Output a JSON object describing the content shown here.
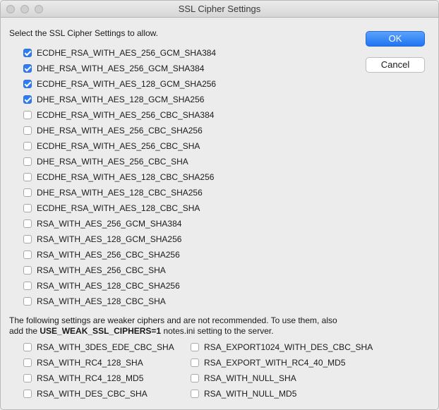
{
  "window": {
    "title": "SSL Cipher Settings"
  },
  "prompt": "Select the SSL Cipher Settings to allow.",
  "buttons": {
    "ok": "OK",
    "cancel": "Cancel"
  },
  "ciphers": [
    {
      "label": "ECDHE_RSA_WITH_AES_256_GCM_SHA384",
      "checked": true
    },
    {
      "label": "DHE_RSA_WITH_AES_256_GCM_SHA384",
      "checked": true
    },
    {
      "label": "ECDHE_RSA_WITH_AES_128_GCM_SHA256",
      "checked": true
    },
    {
      "label": "DHE_RSA_WITH_AES_128_GCM_SHA256",
      "checked": true
    },
    {
      "label": "ECDHE_RSA_WITH_AES_256_CBC_SHA384",
      "checked": false
    },
    {
      "label": "DHE_RSA_WITH_AES_256_CBC_SHA256",
      "checked": false
    },
    {
      "label": "ECDHE_RSA_WITH_AES_256_CBC_SHA",
      "checked": false
    },
    {
      "label": "DHE_RSA_WITH_AES_256_CBC_SHA",
      "checked": false
    },
    {
      "label": "ECDHE_RSA_WITH_AES_128_CBC_SHA256",
      "checked": false
    },
    {
      "label": "DHE_RSA_WITH_AES_128_CBC_SHA256",
      "checked": false
    },
    {
      "label": "ECDHE_RSA_WITH_AES_128_CBC_SHA",
      "checked": false
    },
    {
      "label": "RSA_WITH_AES_256_GCM_SHA384",
      "checked": false
    },
    {
      "label": "RSA_WITH_AES_128_GCM_SHA256",
      "checked": false
    },
    {
      "label": "RSA_WITH_AES_256_CBC_SHA256",
      "checked": false
    },
    {
      "label": "RSA_WITH_AES_256_CBC_SHA",
      "checked": false
    },
    {
      "label": "RSA_WITH_AES_128_CBC_SHA256",
      "checked": false
    },
    {
      "label": "RSA_WITH_AES_128_CBC_SHA",
      "checked": false
    }
  ],
  "weak_notice": {
    "line1": "The following settings are weaker ciphers and are not recommended. To use them, also",
    "line2_prefix": "add the ",
    "line2_bold": "USE_WEAK_SSL_CIPHERS=1",
    "line2_suffix": " notes.ini setting to the server."
  },
  "weak_ciphers_col1": [
    {
      "label": "RSA_WITH_3DES_EDE_CBC_SHA",
      "checked": false
    },
    {
      "label": "RSA_WITH_RC4_128_SHA",
      "checked": false
    },
    {
      "label": "RSA_WITH_RC4_128_MD5",
      "checked": false
    },
    {
      "label": "RSA_WITH_DES_CBC_SHA",
      "checked": false
    }
  ],
  "weak_ciphers_col2": [
    {
      "label": "RSA_EXPORT1024_WITH_DES_CBC_SHA",
      "checked": false
    },
    {
      "label": "RSA_EXPORT_WITH_RC4_40_MD5",
      "checked": false
    },
    {
      "label": "RSA_WITH_NULL_SHA",
      "checked": false
    },
    {
      "label": "RSA_WITH_NULL_MD5",
      "checked": false
    }
  ],
  "colors": {
    "accent": "#2f7cf6",
    "window_bg": "#ececec"
  }
}
